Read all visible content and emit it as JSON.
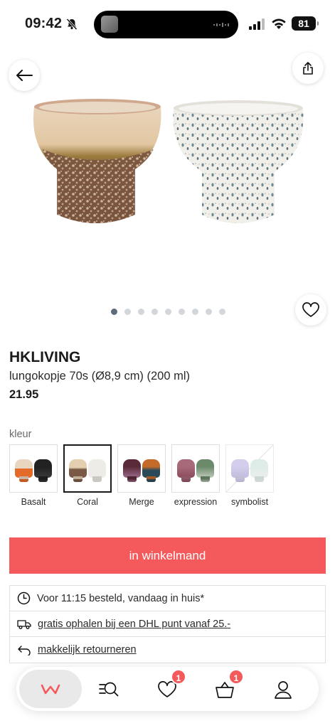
{
  "status_bar": {
    "time": "09:42",
    "battery": "81"
  },
  "product": {
    "brand": "HKLIVING",
    "name": "lungokopje 70s (Ø8,9 cm) (200 ml)",
    "price": "21.95",
    "image_count": 9,
    "active_image_index": 0
  },
  "colors": {
    "label": "kleur",
    "options": [
      {
        "label": "Basalt",
        "selected": false
      },
      {
        "label": "Coral",
        "selected": true
      },
      {
        "label": "Merge",
        "selected": false
      },
      {
        "label": "expression",
        "selected": false
      },
      {
        "label": "symbolist",
        "selected": false
      }
    ]
  },
  "cart_button": {
    "label": "in winkelmand"
  },
  "info": {
    "delivery": "Voor 11:15 besteld, vandaag in huis*",
    "pickup": "gratis ophalen bij een DHL punt vanaf 25.-",
    "returns": "makkelijk retourneren"
  },
  "nav": {
    "home_logo": "w",
    "wishlist_count": "1",
    "cart_count": "1"
  },
  "theme": {
    "accent": "#f4595b",
    "dot_active": "#5d6b7a",
    "dot_inactive": "#d3d6db"
  }
}
